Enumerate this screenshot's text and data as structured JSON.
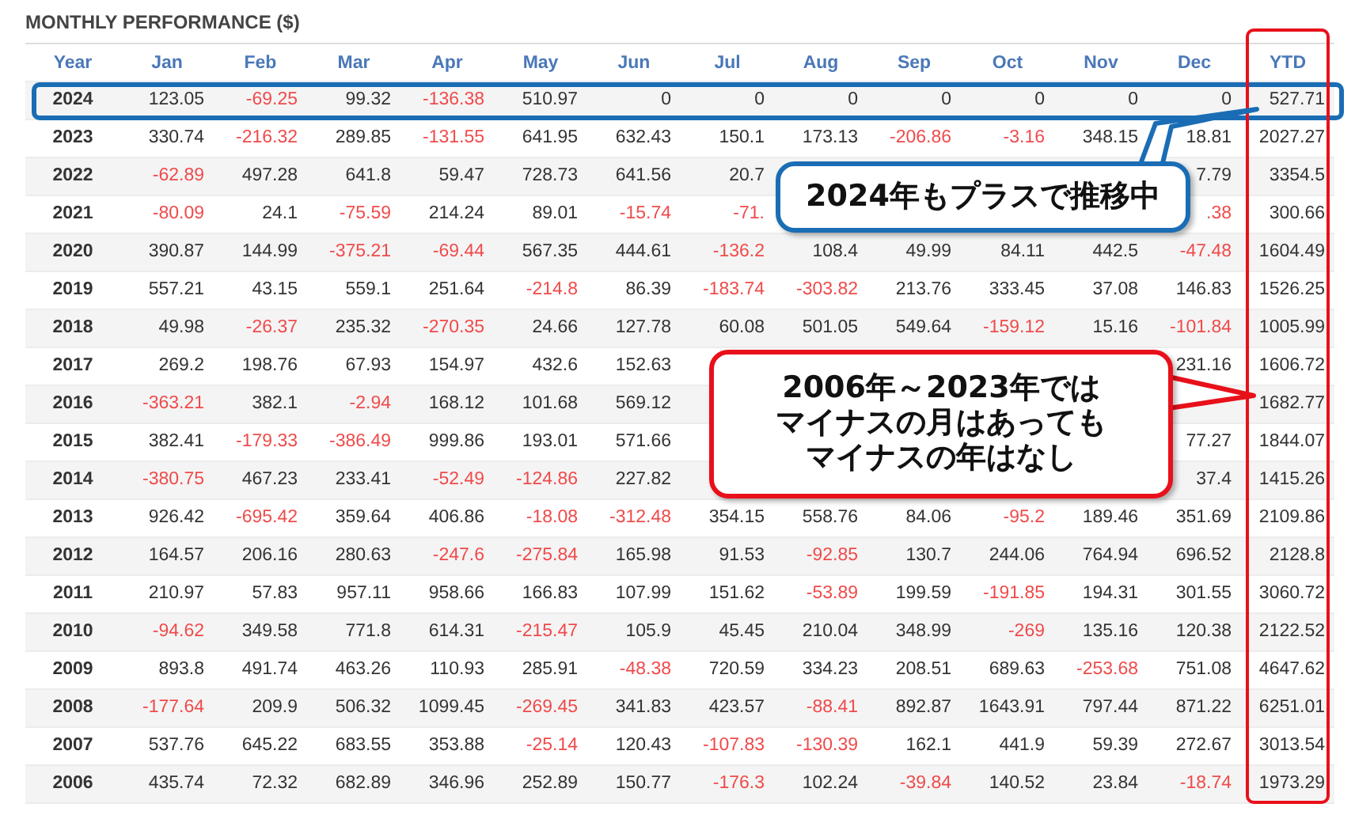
{
  "title": "MONTHLY PERFORMANCE ($)",
  "table": {
    "year_header": "Year",
    "columns": [
      {
        "label": "Jan",
        "highlighted": false
      },
      {
        "label": "Feb",
        "highlighted": false
      },
      {
        "label": "Mar",
        "highlighted": false
      },
      {
        "label": "Apr",
        "highlighted": false
      },
      {
        "label": "May",
        "highlighted": false
      },
      {
        "label": "Jun",
        "highlighted": false
      },
      {
        "label": "Jul",
        "highlighted": false
      },
      {
        "label": "Aug",
        "highlighted": false
      },
      {
        "label": "Sep",
        "highlighted": false
      },
      {
        "label": "Oct",
        "highlighted": false
      },
      {
        "label": "Nov",
        "highlighted": false
      },
      {
        "label": "Dec",
        "highlighted": false
      },
      {
        "label": "YTD",
        "highlighted": true
      }
    ],
    "rows": [
      {
        "year": "2024",
        "highlighted": true,
        "cells": [
          {
            "text": "123.05",
            "negative": false
          },
          {
            "text": "-69.25",
            "negative": true
          },
          {
            "text": "99.32",
            "negative": false
          },
          {
            "text": "-136.38",
            "negative": true
          },
          {
            "text": "510.97",
            "negative": false
          },
          {
            "text": "0",
            "negative": false
          },
          {
            "text": "0",
            "negative": false
          },
          {
            "text": "0",
            "negative": false
          },
          {
            "text": "0",
            "negative": false
          },
          {
            "text": "0",
            "negative": false
          },
          {
            "text": "0",
            "negative": false
          },
          {
            "text": "0",
            "negative": false
          },
          {
            "text": "527.71",
            "negative": false
          }
        ]
      },
      {
        "year": "2023",
        "highlighted": false,
        "cells": [
          {
            "text": "330.74",
            "negative": false
          },
          {
            "text": "-216.32",
            "negative": true
          },
          {
            "text": "289.85",
            "negative": false
          },
          {
            "text": "-131.55",
            "negative": true
          },
          {
            "text": "641.95",
            "negative": false
          },
          {
            "text": "632.43",
            "negative": false
          },
          {
            "text": "150.1",
            "negative": false
          },
          {
            "text": "173.13",
            "negative": false
          },
          {
            "text": "-206.86",
            "negative": true
          },
          {
            "text": "-3.16",
            "negative": true
          },
          {
            "text": "348.15",
            "negative": false
          },
          {
            "text": "18.81",
            "negative": false
          },
          {
            "text": "2027.27",
            "negative": false
          }
        ]
      },
      {
        "year": "2022",
        "highlighted": false,
        "cells": [
          {
            "text": "-62.89",
            "negative": true
          },
          {
            "text": "497.28",
            "negative": false
          },
          {
            "text": "641.8",
            "negative": false
          },
          {
            "text": "59.47",
            "negative": false
          },
          {
            "text": "728.73",
            "negative": false
          },
          {
            "text": "641.56",
            "negative": false
          },
          {
            "text": "20.7",
            "negative": false
          },
          null,
          null,
          null,
          null,
          {
            "text": "7.79",
            "negative": false
          },
          {
            "text": "3354.5",
            "negative": false
          }
        ]
      },
      {
        "year": "2021",
        "highlighted": false,
        "cells": [
          {
            "text": "-80.09",
            "negative": true
          },
          {
            "text": "24.1",
            "negative": false
          },
          {
            "text": "-75.59",
            "negative": true
          },
          {
            "text": "214.24",
            "negative": false
          },
          {
            "text": "89.01",
            "negative": false
          },
          {
            "text": "-15.74",
            "negative": true
          },
          {
            "text": "-71.",
            "negative": true
          },
          null,
          null,
          null,
          null,
          {
            "text": ".38",
            "negative": true
          },
          {
            "text": "300.66",
            "negative": false
          }
        ]
      },
      {
        "year": "2020",
        "highlighted": false,
        "cells": [
          {
            "text": "390.87",
            "negative": false
          },
          {
            "text": "144.99",
            "negative": false
          },
          {
            "text": "-375.21",
            "negative": true
          },
          {
            "text": "-69.44",
            "negative": true
          },
          {
            "text": "567.35",
            "negative": false
          },
          {
            "text": "444.61",
            "negative": false
          },
          {
            "text": "-136.2",
            "negative": true
          },
          {
            "text": "108.4",
            "negative": false
          },
          {
            "text": "49.99",
            "negative": false
          },
          {
            "text": "84.11",
            "negative": false
          },
          {
            "text": "442.5",
            "negative": false
          },
          {
            "text": "-47.48",
            "negative": true
          },
          {
            "text": "1604.49",
            "negative": false
          }
        ]
      },
      {
        "year": "2019",
        "highlighted": false,
        "cells": [
          {
            "text": "557.21",
            "negative": false
          },
          {
            "text": "43.15",
            "negative": false
          },
          {
            "text": "559.1",
            "negative": false
          },
          {
            "text": "251.64",
            "negative": false
          },
          {
            "text": "-214.8",
            "negative": true
          },
          {
            "text": "86.39",
            "negative": false
          },
          {
            "text": "-183.74",
            "negative": true
          },
          {
            "text": "-303.82",
            "negative": true
          },
          {
            "text": "213.76",
            "negative": false
          },
          {
            "text": "333.45",
            "negative": false
          },
          {
            "text": "37.08",
            "negative": false
          },
          {
            "text": "146.83",
            "negative": false
          },
          {
            "text": "1526.25",
            "negative": false
          }
        ]
      },
      {
        "year": "2018",
        "highlighted": false,
        "cells": [
          {
            "text": "49.98",
            "negative": false
          },
          {
            "text": "-26.37",
            "negative": true
          },
          {
            "text": "235.32",
            "negative": false
          },
          {
            "text": "-270.35",
            "negative": true
          },
          {
            "text": "24.66",
            "negative": false
          },
          {
            "text": "127.78",
            "negative": false
          },
          {
            "text": "60.08",
            "negative": false
          },
          {
            "text": "501.05",
            "negative": false
          },
          {
            "text": "549.64",
            "negative": false
          },
          {
            "text": "-159.12",
            "negative": true
          },
          {
            "text": "15.16",
            "negative": false
          },
          {
            "text": "-101.84",
            "negative": true
          },
          {
            "text": "1005.99",
            "negative": false
          }
        ]
      },
      {
        "year": "2017",
        "highlighted": false,
        "cells": [
          {
            "text": "269.2",
            "negative": false
          },
          {
            "text": "198.76",
            "negative": false
          },
          {
            "text": "67.93",
            "negative": false
          },
          {
            "text": "154.97",
            "negative": false
          },
          {
            "text": "432.6",
            "negative": false
          },
          {
            "text": "152.63",
            "negative": false
          },
          null,
          null,
          null,
          null,
          null,
          {
            "text": "231.16",
            "negative": false
          },
          {
            "text": "1606.72",
            "negative": false
          }
        ]
      },
      {
        "year": "2016",
        "highlighted": false,
        "cells": [
          {
            "text": "-363.21",
            "negative": true
          },
          {
            "text": "382.1",
            "negative": false
          },
          {
            "text": "-2.94",
            "negative": true
          },
          {
            "text": "168.12",
            "negative": false
          },
          {
            "text": "101.68",
            "negative": false
          },
          {
            "text": "569.12",
            "negative": false
          },
          null,
          null,
          null,
          null,
          null,
          null,
          {
            "text": "1682.77",
            "negative": false
          }
        ]
      },
      {
        "year": "2015",
        "highlighted": false,
        "cells": [
          {
            "text": "382.41",
            "negative": false
          },
          {
            "text": "-179.33",
            "negative": true
          },
          {
            "text": "-386.49",
            "negative": true
          },
          {
            "text": "999.86",
            "negative": false
          },
          {
            "text": "193.01",
            "negative": false
          },
          {
            "text": "571.66",
            "negative": false
          },
          null,
          null,
          null,
          null,
          null,
          {
            "text": "77.27",
            "negative": false
          },
          {
            "text": "1844.07",
            "negative": false
          }
        ]
      },
      {
        "year": "2014",
        "highlighted": false,
        "cells": [
          {
            "text": "-380.75",
            "negative": true
          },
          {
            "text": "467.23",
            "negative": false
          },
          {
            "text": "233.41",
            "negative": false
          },
          {
            "text": "-52.49",
            "negative": true
          },
          {
            "text": "-124.86",
            "negative": true
          },
          {
            "text": "227.82",
            "negative": false
          },
          null,
          null,
          null,
          null,
          null,
          {
            "text": "37.4",
            "negative": false
          },
          {
            "text": "1415.26",
            "negative": false
          }
        ]
      },
      {
        "year": "2013",
        "highlighted": false,
        "cells": [
          {
            "text": "926.42",
            "negative": false
          },
          {
            "text": "-695.42",
            "negative": true
          },
          {
            "text": "359.64",
            "negative": false
          },
          {
            "text": "406.86",
            "negative": false
          },
          {
            "text": "-18.08",
            "negative": true
          },
          {
            "text": "-312.48",
            "negative": true
          },
          {
            "text": "354.15",
            "negative": false
          },
          {
            "text": "558.76",
            "negative": false
          },
          {
            "text": "84.06",
            "negative": false
          },
          {
            "text": "-95.2",
            "negative": true
          },
          {
            "text": "189.46",
            "negative": false
          },
          {
            "text": "351.69",
            "negative": false
          },
          {
            "text": "2109.86",
            "negative": false
          }
        ]
      },
      {
        "year": "2012",
        "highlighted": false,
        "cells": [
          {
            "text": "164.57",
            "negative": false
          },
          {
            "text": "206.16",
            "negative": false
          },
          {
            "text": "280.63",
            "negative": false
          },
          {
            "text": "-247.6",
            "negative": true
          },
          {
            "text": "-275.84",
            "negative": true
          },
          {
            "text": "165.98",
            "negative": false
          },
          {
            "text": "91.53",
            "negative": false
          },
          {
            "text": "-92.85",
            "negative": true
          },
          {
            "text": "130.7",
            "negative": false
          },
          {
            "text": "244.06",
            "negative": false
          },
          {
            "text": "764.94",
            "negative": false
          },
          {
            "text": "696.52",
            "negative": false
          },
          {
            "text": "2128.8",
            "negative": false
          }
        ]
      },
      {
        "year": "2011",
        "highlighted": false,
        "cells": [
          {
            "text": "210.97",
            "negative": false
          },
          {
            "text": "57.83",
            "negative": false
          },
          {
            "text": "957.11",
            "negative": false
          },
          {
            "text": "958.66",
            "negative": false
          },
          {
            "text": "166.83",
            "negative": false
          },
          {
            "text": "107.99",
            "negative": false
          },
          {
            "text": "151.62",
            "negative": false
          },
          {
            "text": "-53.89",
            "negative": true
          },
          {
            "text": "199.59",
            "negative": false
          },
          {
            "text": "-191.85",
            "negative": true
          },
          {
            "text": "194.31",
            "negative": false
          },
          {
            "text": "301.55",
            "negative": false
          },
          {
            "text": "3060.72",
            "negative": false
          }
        ]
      },
      {
        "year": "2010",
        "highlighted": false,
        "cells": [
          {
            "text": "-94.62",
            "negative": true
          },
          {
            "text": "349.58",
            "negative": false
          },
          {
            "text": "771.8",
            "negative": false
          },
          {
            "text": "614.31",
            "negative": false
          },
          {
            "text": "-215.47",
            "negative": true
          },
          {
            "text": "105.9",
            "negative": false
          },
          {
            "text": "45.45",
            "negative": false
          },
          {
            "text": "210.04",
            "negative": false
          },
          {
            "text": "348.99",
            "negative": false
          },
          {
            "text": "-269",
            "negative": true
          },
          {
            "text": "135.16",
            "negative": false
          },
          {
            "text": "120.38",
            "negative": false
          },
          {
            "text": "2122.52",
            "negative": false
          }
        ]
      },
      {
        "year": "2009",
        "highlighted": false,
        "cells": [
          {
            "text": "893.8",
            "negative": false
          },
          {
            "text": "491.74",
            "negative": false
          },
          {
            "text": "463.26",
            "negative": false
          },
          {
            "text": "110.93",
            "negative": false
          },
          {
            "text": "285.91",
            "negative": false
          },
          {
            "text": "-48.38",
            "negative": true
          },
          {
            "text": "720.59",
            "negative": false
          },
          {
            "text": "334.23",
            "negative": false
          },
          {
            "text": "208.51",
            "negative": false
          },
          {
            "text": "689.63",
            "negative": false
          },
          {
            "text": "-253.68",
            "negative": true
          },
          {
            "text": "751.08",
            "negative": false
          },
          {
            "text": "4647.62",
            "negative": false
          }
        ]
      },
      {
        "year": "2008",
        "highlighted": false,
        "cells": [
          {
            "text": "-177.64",
            "negative": true
          },
          {
            "text": "209.9",
            "negative": false
          },
          {
            "text": "506.32",
            "negative": false
          },
          {
            "text": "1099.45",
            "negative": false
          },
          {
            "text": "-269.45",
            "negative": true
          },
          {
            "text": "341.83",
            "negative": false
          },
          {
            "text": "423.57",
            "negative": false
          },
          {
            "text": "-88.41",
            "negative": true
          },
          {
            "text": "892.87",
            "negative": false
          },
          {
            "text": "1643.91",
            "negative": false
          },
          {
            "text": "797.44",
            "negative": false
          },
          {
            "text": "871.22",
            "negative": false
          },
          {
            "text": "6251.01",
            "negative": false
          }
        ]
      },
      {
        "year": "2007",
        "highlighted": false,
        "cells": [
          {
            "text": "537.76",
            "negative": false
          },
          {
            "text": "645.22",
            "negative": false
          },
          {
            "text": "683.55",
            "negative": false
          },
          {
            "text": "353.88",
            "negative": false
          },
          {
            "text": "-25.14",
            "negative": true
          },
          {
            "text": "120.43",
            "negative": false
          },
          {
            "text": "-107.83",
            "negative": true
          },
          {
            "text": "-130.39",
            "negative": true
          },
          {
            "text": "162.1",
            "negative": false
          },
          {
            "text": "441.9",
            "negative": false
          },
          {
            "text": "59.39",
            "negative": false
          },
          {
            "text": "272.67",
            "negative": false
          },
          {
            "text": "3013.54",
            "negative": false
          }
        ]
      },
      {
        "year": "2006",
        "highlighted": false,
        "cells": [
          {
            "text": "435.74",
            "negative": false
          },
          {
            "text": "72.32",
            "negative": false
          },
          {
            "text": "682.89",
            "negative": false
          },
          {
            "text": "346.96",
            "negative": false
          },
          {
            "text": "252.89",
            "negative": false
          },
          {
            "text": "150.77",
            "negative": false
          },
          {
            "text": "-176.3",
            "negative": true
          },
          {
            "text": "102.24",
            "negative": false
          },
          {
            "text": "-39.84",
            "negative": true
          },
          {
            "text": "140.52",
            "negative": false
          },
          {
            "text": "23.84",
            "negative": false
          },
          {
            "text": "-18.74",
            "negative": true
          },
          {
            "text": "1973.29",
            "negative": false
          }
        ]
      }
    ]
  },
  "callouts": [
    {
      "color": "#1a6db5",
      "lines": [
        "2024年もプラスで推移中"
      ]
    },
    {
      "color": "#e8101a",
      "lines": [
        "2006年～2023年では",
        "マイナスの月はあっても",
        "マイナスの年はなし"
      ]
    }
  ]
}
